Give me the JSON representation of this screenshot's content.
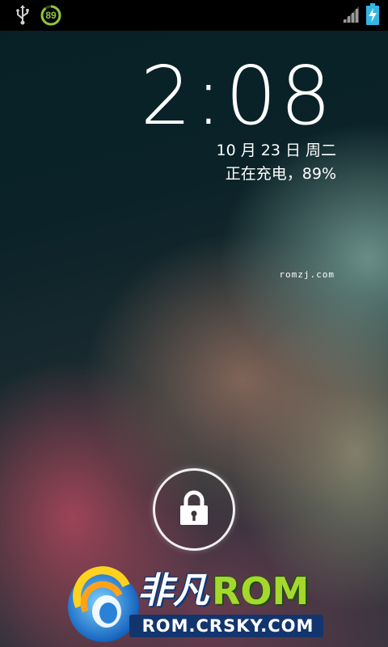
{
  "status_bar": {
    "usb_icon": "usb-icon",
    "battery_ring_value": "89",
    "signal_icon": "cell-signal-icon",
    "battery_icon": "battery-charging-icon",
    "accent_color": "#8ec641"
  },
  "lockscreen": {
    "time": "2:08",
    "date": "10 月 23 日 周二",
    "charging_status": "正在充电，89%",
    "watermark": "romzj.com",
    "unlock_icon": "lock-icon"
  },
  "logo": {
    "name_cn": "非凡",
    "name_rom": "ROM",
    "url": "ROM.CRSKY.COM"
  }
}
